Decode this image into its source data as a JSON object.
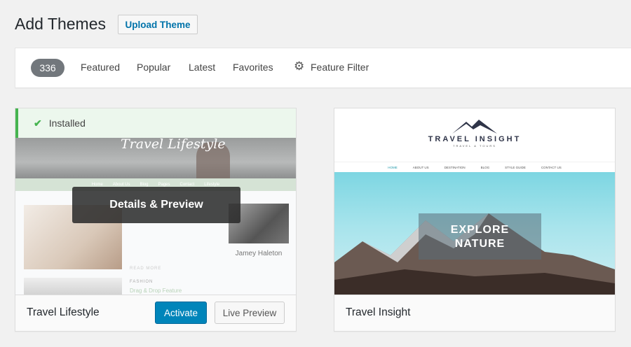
{
  "header": {
    "title": "Add Themes",
    "upload_label": "Upload Theme"
  },
  "filters": {
    "count": "336",
    "tabs": [
      "Featured",
      "Popular",
      "Latest",
      "Favorites"
    ],
    "feature_filter": "Feature Filter",
    "feature_filter_icon": "gear-icon"
  },
  "themes": [
    {
      "name": "Travel Lifestyle",
      "installed_label": "Installed",
      "overlay_label": "Details & Preview",
      "activate_label": "Activate",
      "live_preview_label": "Live Preview",
      "preview": {
        "logo": "Travel Lifestyle",
        "nav": [
          "Home",
          "About Us",
          "Blog",
          "Pages",
          "Contact",
          "Lifestyle"
        ],
        "author": "Jamey Haleton",
        "post_title": "Drag & Drop Feature",
        "section": "FASHION",
        "read_more": "READ MORE"
      }
    },
    {
      "name": "Travel Insight",
      "preview": {
        "logo": "TRAVEL INSIGHT",
        "tagline": "TRAVEL & TOURS",
        "nav": [
          "HOME",
          "ABOUT US",
          "DESTINATION",
          "BLOG",
          "STYLE GUIDE",
          "CONTACT US"
        ],
        "hero_line1": "EXPLORE",
        "hero_line2": "NATURE"
      }
    }
  ],
  "colors": {
    "primary": "#0085ba",
    "installed_green": "#46b450",
    "badge": "#72777c"
  }
}
